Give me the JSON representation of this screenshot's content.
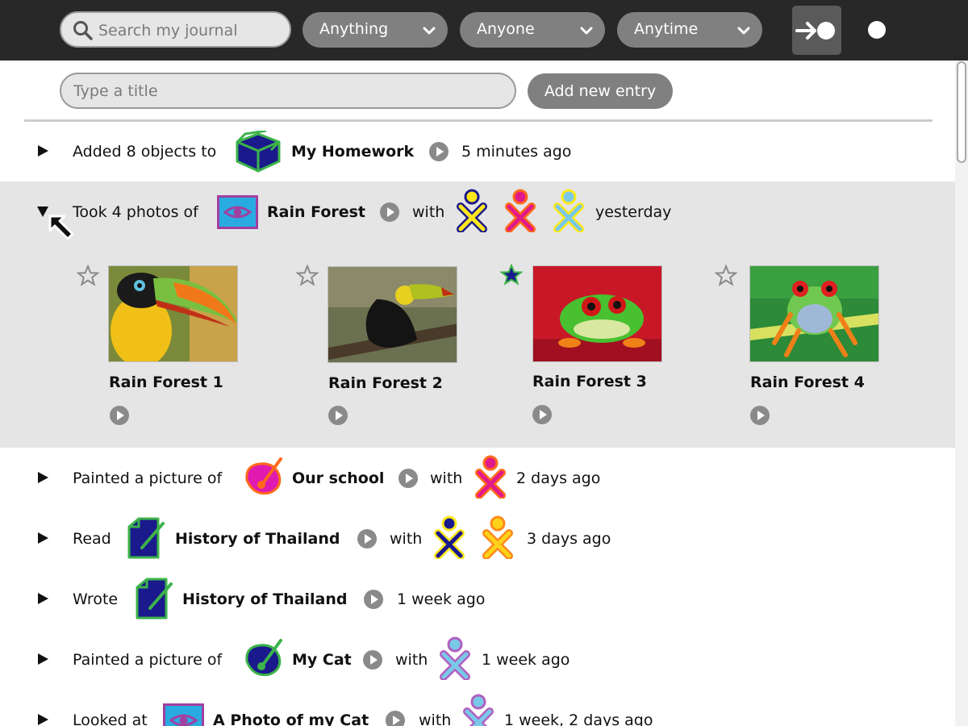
{
  "toolbar": {
    "search_placeholder": "Search my journal",
    "filters": [
      {
        "label": "Anything"
      },
      {
        "label": "Anyone"
      },
      {
        "label": "Anytime"
      }
    ]
  },
  "entry_bar": {
    "title_placeholder": "Type a title",
    "add_label": "Add new entry"
  },
  "rows": [
    {
      "verb": "Added 8 objects to",
      "object": "My Homework",
      "time": "5 minutes ago"
    },
    {
      "verb": "Took 4 photos of",
      "object": "Rain Forest",
      "with": "with",
      "time": "yesterday",
      "photos": [
        {
          "title": "Rain Forest 1",
          "starred": false
        },
        {
          "title": "Rain Forest 2",
          "starred": false
        },
        {
          "title": "Rain Forest 3",
          "starred": true
        },
        {
          "title": "Rain Forest 4",
          "starred": false
        }
      ]
    },
    {
      "verb": "Painted a picture of",
      "object": "Our school",
      "with": "with",
      "time": "2 days ago"
    },
    {
      "verb": "Read",
      "object": "History of Thailand",
      "with": "with",
      "time": "3 days ago"
    },
    {
      "verb": "Wrote",
      "object": "History of Thailand",
      "time": "1 week ago"
    },
    {
      "verb": "Painted a picture of",
      "object": "My Cat",
      "with": "with",
      "time": "1 week ago"
    },
    {
      "verb": "Looked at",
      "object": "A Photo of my Cat",
      "with": "with",
      "time": "1 week, 2 days ago"
    }
  ],
  "colors": {
    "toolbar_bg": "#282828",
    "expanded_bg": "#e5e5e5",
    "pill_bg": "#808080",
    "xo_green": "#3cb34a",
    "xo_blue": "#1a1a8c"
  }
}
